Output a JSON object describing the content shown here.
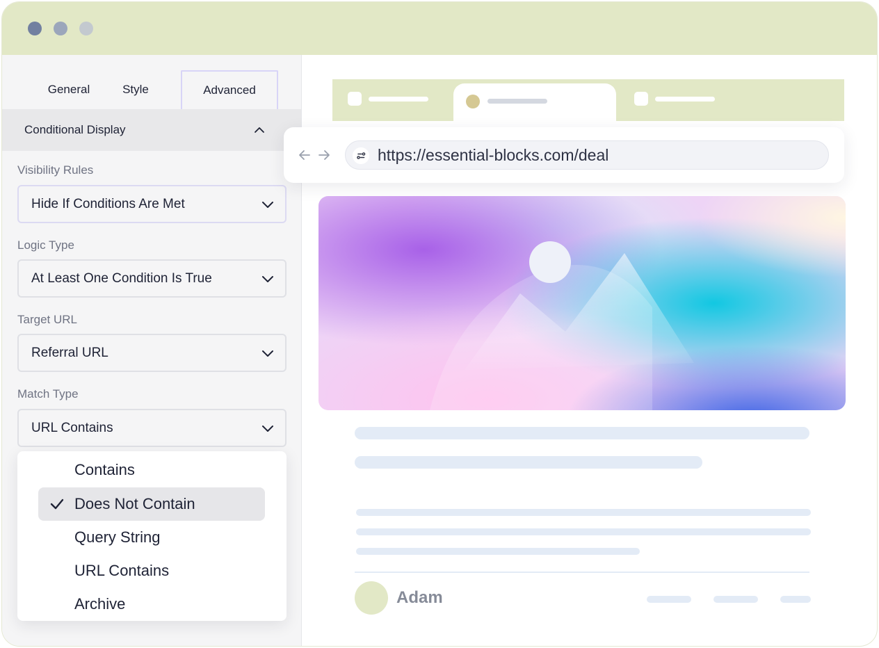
{
  "window": {
    "controls": [
      "close-dot",
      "minimize-dot",
      "maximize-dot"
    ]
  },
  "sidebar": {
    "tabs": [
      {
        "label": "General",
        "active": false
      },
      {
        "label": "Style",
        "active": false
      },
      {
        "label": "Advanced",
        "active": true
      }
    ],
    "section_title": "Conditional Display",
    "section_icon": "chevron-up-icon",
    "fields": {
      "visibility_rules": {
        "label": "Visibility Rules",
        "value": "Hide If Conditions Are Met"
      },
      "logic_type": {
        "label": "Logic Type",
        "value": "At Least One Condition Is True"
      },
      "target_url": {
        "label": "Target URL",
        "value": "Referral URL"
      },
      "match_type": {
        "label": "Match Type",
        "value": "URL Contains"
      }
    },
    "dropdown_options": [
      {
        "label": "Contains",
        "selected": false
      },
      {
        "label": "Does Not Contain",
        "selected": true
      },
      {
        "label": "Query String",
        "selected": false
      },
      {
        "label": "URL Contains",
        "selected": false
      },
      {
        "label": "Archive",
        "selected": false
      }
    ]
  },
  "preview": {
    "url": "https://essential-blocks.com/deal",
    "author": "Adam",
    "colors": {
      "titlebar": "#e2e8c6",
      "accent_border": "#d8d4f7",
      "skeleton": "#e3ebf6"
    }
  }
}
